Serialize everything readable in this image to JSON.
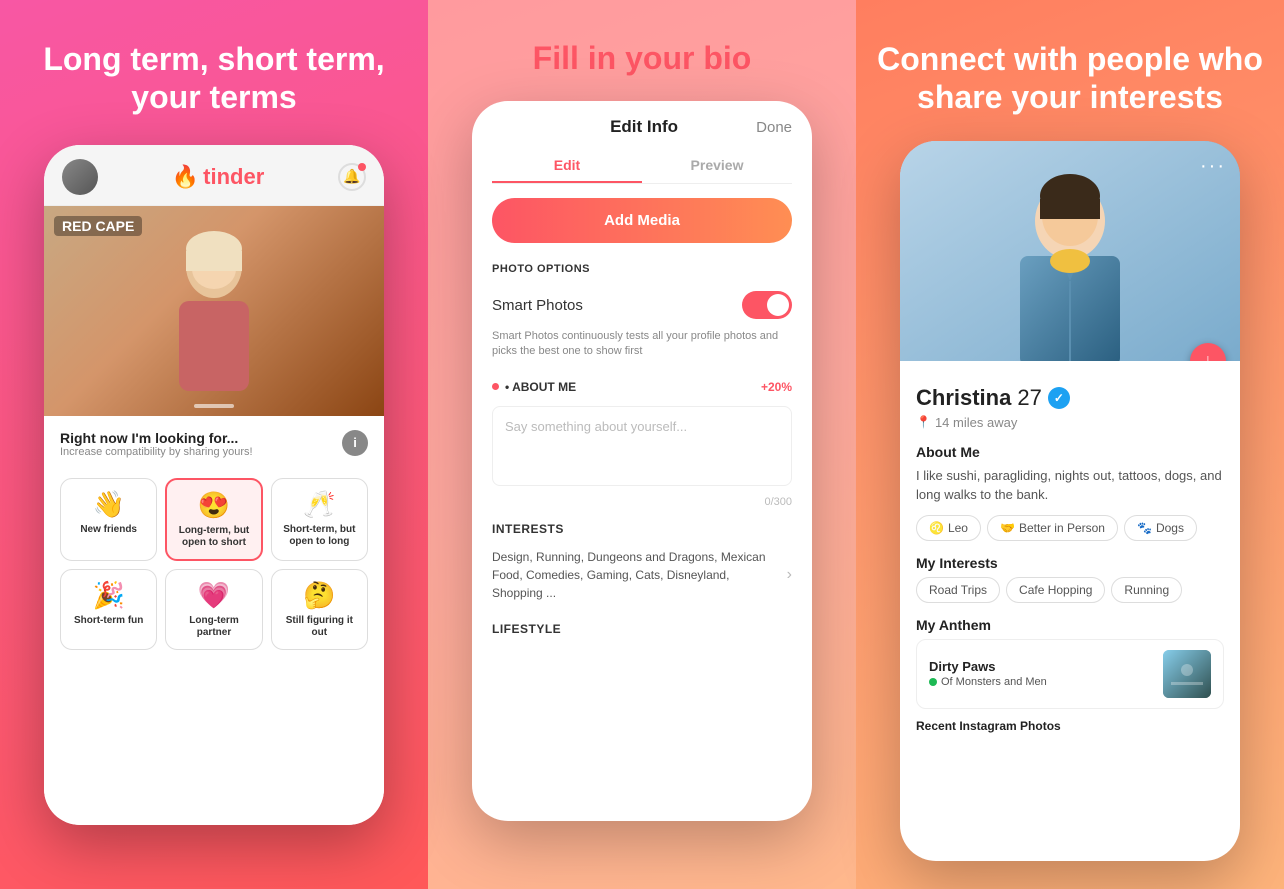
{
  "panel1": {
    "headline": "Long term, short term, your terms",
    "header": {
      "logo": "🔥 tinder"
    },
    "profile_photo_bar": "RED CAPE",
    "bottom_sheet": {
      "title": "Right now I'm looking for...",
      "subtitle": "Increase compatibility by sharing yours!",
      "options": [
        {
          "emoji": "👋",
          "label": "New friends",
          "selected": false
        },
        {
          "emoji": "😍",
          "label": "Long-term, but open to short",
          "selected": true
        },
        {
          "emoji": "🥂",
          "label": "Short-term, but open to long",
          "selected": false
        },
        {
          "emoji": "🎉",
          "label": "Short-term fun",
          "selected": false
        },
        {
          "emoji": "💗",
          "label": "Long-term partner",
          "selected": false
        },
        {
          "emoji": "🤔",
          "label": "Still figuring it out",
          "selected": false
        }
      ]
    }
  },
  "panel2": {
    "headline": "Fill in your bio",
    "edit_info": {
      "title": "Edit Info",
      "done": "Done",
      "tab_edit": "Edit",
      "tab_preview": "Preview",
      "add_media": "Add Media",
      "photo_options": "PHOTO OPTIONS",
      "smart_photos_label": "Smart Photos",
      "smart_photos_desc": "Smart Photos continuously tests all your profile photos and picks the best one to show first",
      "about_me_label": "• ABOUT ME",
      "about_me_pct": "+20%",
      "bio_placeholder": "Say something about yourself...",
      "char_count": "0/300",
      "interests_label": "INTERESTS",
      "interests_text": "Design, Running, Dungeons and Dragons, Mexican Food, Comedies, Gaming, Cats, Disneyland, Shopping ...",
      "lifestyle_label": "LIFESTYLE"
    }
  },
  "panel3": {
    "headline": "Connect with people who share your interests",
    "profile": {
      "name": "Christina",
      "age": "27",
      "distance": "14 miles away",
      "about_title": "About Me",
      "about_text": "I like sushi, paragliding, nights out, tattoos, dogs, and long walks to the bank.",
      "badges": [
        {
          "icon": "♌",
          "label": "Leo"
        },
        {
          "icon": "🤝",
          "label": "Better in Person"
        },
        {
          "icon": "🐾",
          "label": "Dogs"
        }
      ],
      "interests_title": "My Interests",
      "interests": [
        "Road Trips",
        "Cafe Hopping",
        "Running"
      ],
      "anthem_title": "My Anthem",
      "anthem_song": "Dirty Paws",
      "anthem_artist": "Of Monsters and Men",
      "instagram_label": "Recent Instagram Photos"
    }
  }
}
